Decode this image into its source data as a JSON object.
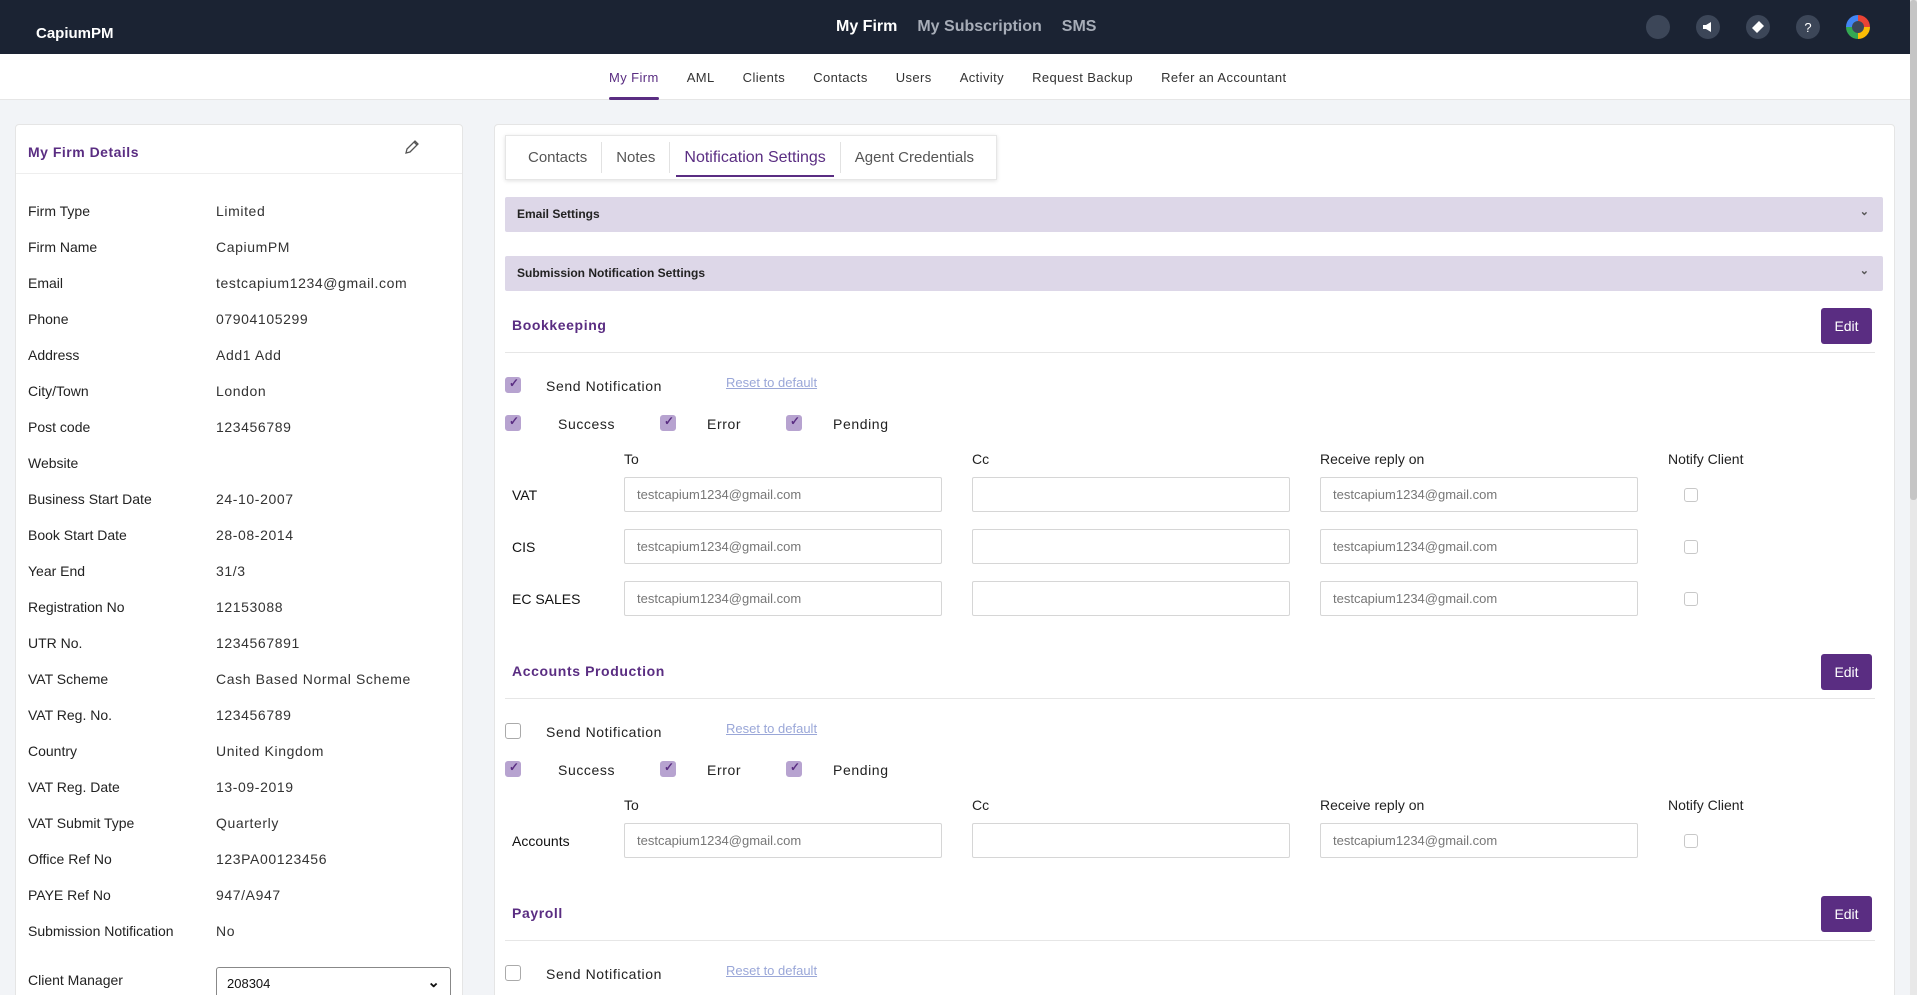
{
  "app": {
    "brand": "CapiumPM"
  },
  "topnav": [
    {
      "label": "My Firm",
      "active": true
    },
    {
      "label": "My Subscription",
      "active": false
    },
    {
      "label": "SMS",
      "active": false
    }
  ],
  "top_icons": [
    "circle-icon",
    "megaphone-icon",
    "ticket-icon",
    "help-icon",
    "google-account-icon"
  ],
  "subnav": [
    "My Firm",
    "AML",
    "Clients",
    "Contacts",
    "Users",
    "Activity",
    "Request Backup",
    "Refer an Accountant"
  ],
  "firm_details": {
    "title": "My Firm Details",
    "rows": [
      {
        "label": "Firm Type",
        "value": "Limited"
      },
      {
        "label": "Firm Name",
        "value": "CapiumPM"
      },
      {
        "label": "Email",
        "value": "testcapium1234@gmail.com"
      },
      {
        "label": "Phone",
        "value": "07904105299"
      },
      {
        "label": "Address",
        "value": "Add1 Add"
      },
      {
        "label": "City/Town",
        "value": "London"
      },
      {
        "label": "Post code",
        "value": "123456789"
      },
      {
        "label": "Website",
        "value": ""
      },
      {
        "label": "Business Start Date",
        "value": "24-10-2007"
      },
      {
        "label": "Book Start Date",
        "value": "28-08-2014"
      },
      {
        "label": "Year End",
        "value": "31/3"
      },
      {
        "label": "Registration No",
        "value": "12153088"
      },
      {
        "label": "UTR No.",
        "value": "1234567891"
      },
      {
        "label": "VAT Scheme",
        "value": "Cash Based Normal Scheme"
      },
      {
        "label": "VAT Reg. No.",
        "value": "123456789"
      },
      {
        "label": "Country",
        "value": "United Kingdom"
      },
      {
        "label": "VAT Reg. Date",
        "value": "13-09-2019"
      },
      {
        "label": "VAT Submit Type",
        "value": "Quarterly"
      },
      {
        "label": "Office Ref No",
        "value": "123PA00123456"
      },
      {
        "label": "PAYE Ref No",
        "value": "947/A947"
      },
      {
        "label": "Submission Notification",
        "value": "No"
      }
    ],
    "client_manager": {
      "label": "Client Manager",
      "value": "208304"
    }
  },
  "tabs": [
    {
      "label": "Contacts",
      "active": false
    },
    {
      "label": "Notes",
      "active": false
    },
    {
      "label": "Notification Settings",
      "active": true
    },
    {
      "label": "Agent Credentials",
      "active": false
    }
  ],
  "accordions": {
    "email": "Email Settings",
    "submission": "Submission Notification Settings"
  },
  "labels": {
    "edit": "Edit",
    "send_notification": "Send Notification",
    "reset": "Reset to default",
    "success": "Success",
    "error": "Error",
    "pending": "Pending",
    "col_to": "To",
    "col_cc": "Cc",
    "col_reply": "Receive reply on",
    "col_notify": "Notify Client"
  },
  "sections": {
    "bookkeeping": {
      "title": "Bookkeeping",
      "send_notification": true,
      "success": true,
      "error": true,
      "pending": true,
      "rows": [
        {
          "label": "VAT",
          "to": "testcapium1234@gmail.com",
          "cc": "",
          "reply": "testcapium1234@gmail.com",
          "notify": false
        },
        {
          "label": "CIS",
          "to": "testcapium1234@gmail.com",
          "cc": "",
          "reply": "testcapium1234@gmail.com",
          "notify": false
        },
        {
          "label": "EC SALES",
          "to": "testcapium1234@gmail.com",
          "cc": "",
          "reply": "testcapium1234@gmail.com",
          "notify": false
        }
      ]
    },
    "accounts": {
      "title": "Accounts Production",
      "send_notification": false,
      "success": true,
      "error": true,
      "pending": true,
      "rows": [
        {
          "label": "Accounts",
          "to": "testcapium1234@gmail.com",
          "cc": "",
          "reply": "testcapium1234@gmail.com",
          "notify": false
        }
      ]
    },
    "payroll": {
      "title": "Payroll",
      "send_notification": false
    }
  },
  "colors": {
    "brand": "#5a2d82",
    "topbar": "#1b2333",
    "accordion": "#ddd7e8",
    "checkbox": "#b7a3d0"
  }
}
